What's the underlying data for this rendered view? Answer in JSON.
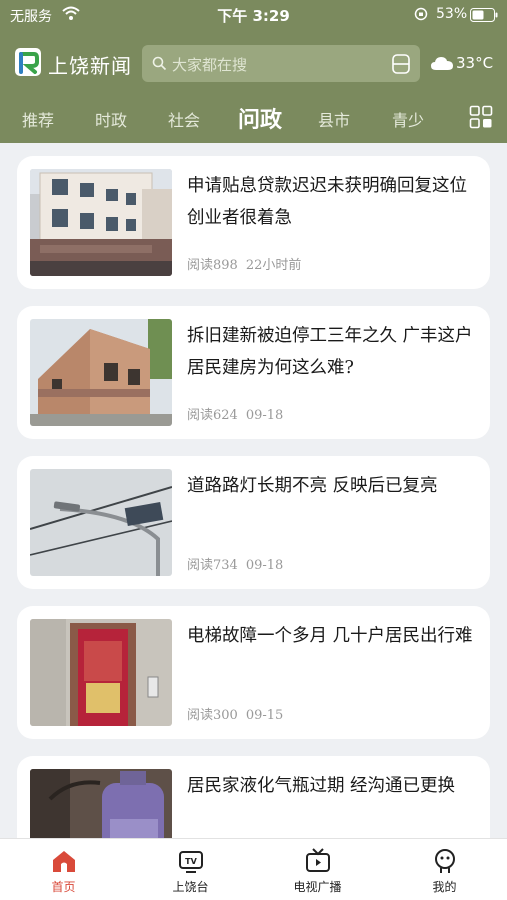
{
  "status": {
    "carrier": "无服务",
    "time": "下午 3:29",
    "battery": "53%"
  },
  "app": {
    "title": "上饶新闻",
    "search_placeholder": "大家都在搜",
    "temperature": "33°C"
  },
  "tabs": [
    {
      "label": "推荐"
    },
    {
      "label": "时政"
    },
    {
      "label": "社会"
    },
    {
      "label": "问政",
      "active": true
    },
    {
      "label": "县市"
    },
    {
      "label": "青少"
    }
  ],
  "articles": [
    {
      "title": "申请贴息贷款迟迟未获明确回复这位创业者很着急",
      "reads": "阅读898",
      "time": "22小时前",
      "image": "building-photo"
    },
    {
      "title": "拆旧建新被迫停工三年之久 广丰这户居民建房为何这么难?",
      "reads": "阅读624",
      "time": "09-18",
      "image": "construction-photo"
    },
    {
      "title": "道路路灯长期不亮 反映后已复亮",
      "reads": "阅读734",
      "time": "09-18",
      "image": "streetlight-photo"
    },
    {
      "title": "电梯故障一个多月 几十户居民出行难",
      "reads": "阅读300",
      "time": "09-15",
      "image": "elevator-photo"
    },
    {
      "title": "居民家液化气瓶过期 经沟通已更换",
      "reads": "",
      "time": "",
      "image": "gas-cylinder-photo"
    }
  ],
  "bottom_nav": [
    {
      "label": "首页",
      "icon": "home-icon",
      "active": true
    },
    {
      "label": "上饶台",
      "icon": "tv-icon"
    },
    {
      "label": "电视广播",
      "icon": "broadcast-icon"
    },
    {
      "label": "我的",
      "icon": "profile-icon"
    }
  ],
  "colors": {
    "header": "#7b8a5e",
    "active_nav": "#d94a3a",
    "background": "#eef0f3"
  }
}
